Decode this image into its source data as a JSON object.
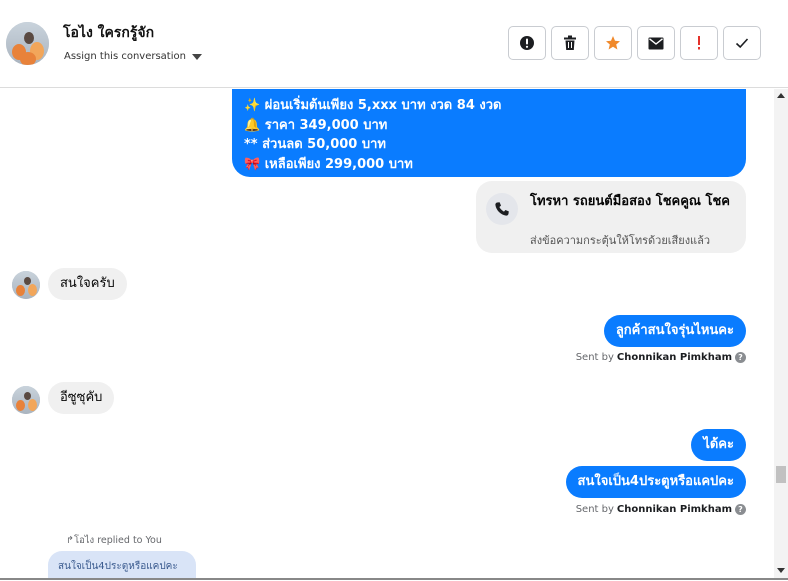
{
  "header": {
    "contact_name": "โอไง ใครกรู้จัก",
    "assign_label": "Assign this conversation"
  },
  "toolbar": [
    {
      "name": "spam-alert-button",
      "icon": "alert-circle-icon"
    },
    {
      "name": "delete-button",
      "icon": "trash-icon"
    },
    {
      "name": "star-button",
      "icon": "star-icon",
      "color": "#f0892b"
    },
    {
      "name": "mark-unread-button",
      "icon": "envelope-icon"
    },
    {
      "name": "follow-up-button",
      "icon": "exclamation-icon",
      "color": "#e4322b"
    },
    {
      "name": "mark-done-button",
      "icon": "checkmark-icon"
    }
  ],
  "messages": {
    "promo_lines": [
      "✨ ผ่อนเริ่มต้นเพียง 5,xxx บาท งวด 84 งวด",
      "🔔 ราคา 349,000 บาท",
      "** ส่วนลด 50,000 บาท",
      "🎀 เหลือเพียง 299,000 บาท"
    ],
    "call_card": {
      "title": "โทรหา รถยนต์มือสอง โชคคูณ โชค",
      "subtitle": "ส่งข้อความกระตุ้นให้โทรด้วยเสียงแล้ว"
    },
    "in_1": "สนใจครับ",
    "out_1": "ลูกค้าสนใจรุ่นไหนคะ",
    "sent_by_prefix": "Sent by",
    "agent_name": "Chonnikan Pimkham",
    "help_glyph": "?",
    "in_2": "อีซูซุคับ",
    "out_2": "ได้คะ",
    "out_3": "สนใจเป็น4ประตูหรือแคปคะ",
    "reply_meta": "↱โอไง replied to You",
    "reply_quote": "สนใจเป็น4ประตูหรือแคปคะ"
  },
  "colors": {
    "outgoing_bubble": "#0a7cff",
    "incoming_bubble": "#f0f0f0",
    "reply_quote": "#d9e4f7"
  }
}
